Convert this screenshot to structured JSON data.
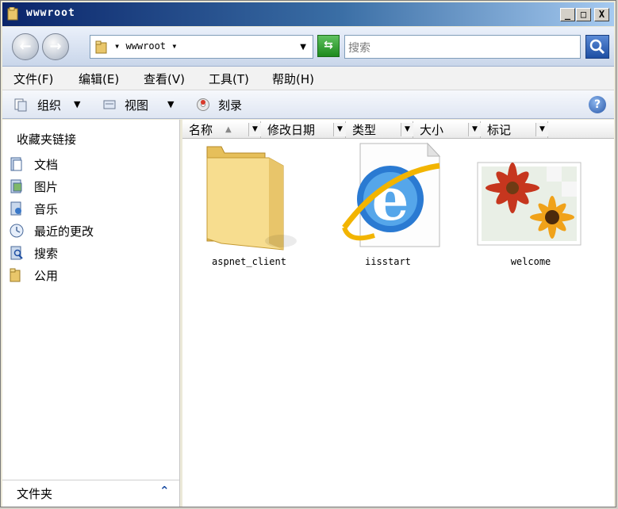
{
  "window": {
    "title": "wwwroot"
  },
  "title_buttons": {
    "minimize": "_",
    "maximize": "□",
    "close": "X"
  },
  "address": {
    "path": "▾ wwwroot ▾",
    "dropdown": "▼"
  },
  "search": {
    "placeholder": "搜索"
  },
  "menu": [
    "文件(F)",
    "编辑(E)",
    "查看(V)",
    "工具(T)",
    "帮助(H)"
  ],
  "toolbar": {
    "organize": "组织",
    "views": "视图",
    "burn": "刻录",
    "arrow": "▼"
  },
  "favorites": {
    "title": "收藏夹链接",
    "links": [
      "文档",
      "图片",
      "音乐",
      "最近的更改",
      "搜索",
      "公用"
    ]
  },
  "folders_bar": {
    "label": "文件夹",
    "chevron": "⌃"
  },
  "columns": [
    "名称",
    "修改日期",
    "类型",
    "大小",
    "标记"
  ],
  "items": [
    {
      "name": "aspnet_client",
      "icon": "folder-icon"
    },
    {
      "name": "iisstart",
      "icon": "ie-document-icon"
    },
    {
      "name": "welcome",
      "icon": "image-icon"
    }
  ],
  "colors": {
    "titlebar": "#0a246a",
    "accent": "#1d4ea3"
  }
}
